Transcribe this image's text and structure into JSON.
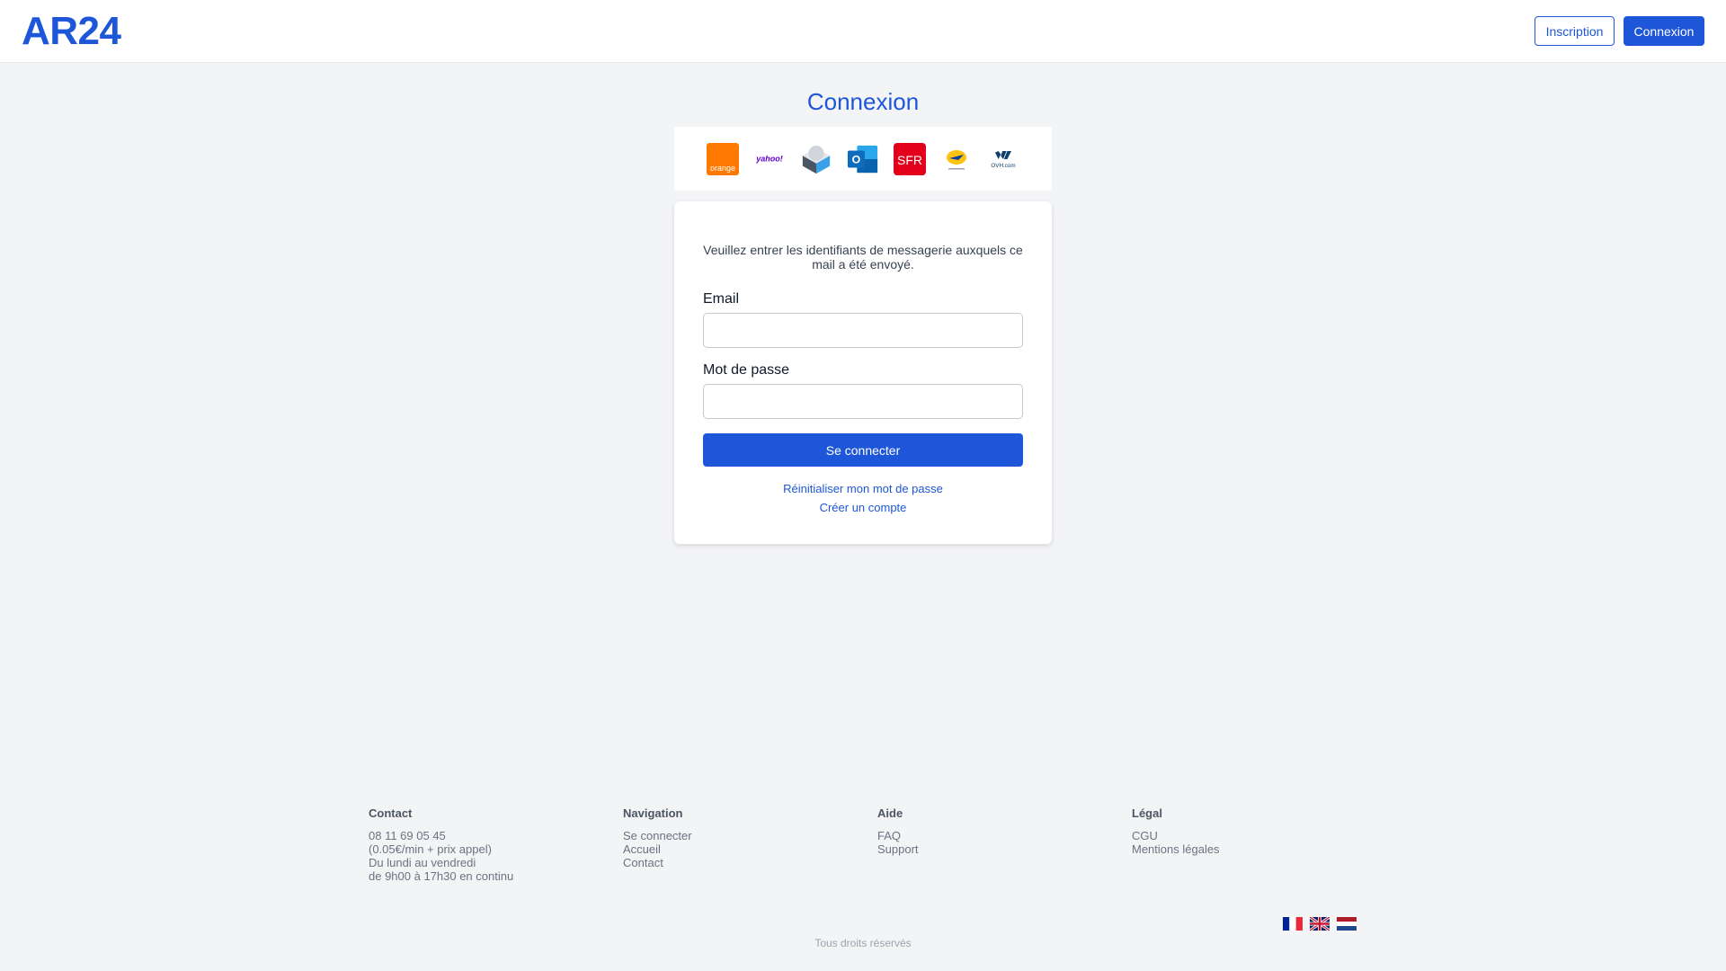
{
  "header": {
    "logo": "AR24",
    "signup_label": "Inscription",
    "login_label": "Connexion"
  },
  "page": {
    "title": "Connexion"
  },
  "providers": [
    {
      "name": "orange-logo-icon",
      "label": "orange"
    },
    {
      "name": "yahoo-logo-icon",
      "label": "yahoo!"
    },
    {
      "name": "mailbox-logo-icon"
    },
    {
      "name": "outlook-logo-icon",
      "label": "O"
    },
    {
      "name": "sfr-logo-icon",
      "label": "SFR"
    },
    {
      "name": "laposte-logo-icon"
    },
    {
      "name": "ovh-logo-icon",
      "label": "OVH.com"
    }
  ],
  "form": {
    "intro": "Veuillez entrer les identifiants de messagerie auxquels ce mail a été envoyé.",
    "email_label": "Email",
    "email_value": "",
    "password_label": "Mot de passe",
    "password_value": "",
    "submit_label": "Se connecter",
    "reset_link": "Réinitialiser mon mot de passe",
    "create_link": "Créer un compte"
  },
  "footer": {
    "contact": {
      "title": "Contact",
      "lines": [
        "08 11 69 05 45",
        "(0.05€/min + prix appel)",
        "Du lundi au vendredi",
        "de 9h00 à 17h30 en continu"
      ]
    },
    "navigation": {
      "title": "Navigation",
      "items": [
        "Se connecter",
        "Accueil",
        "Contact"
      ]
    },
    "aide": {
      "title": "Aide",
      "items": [
        "FAQ",
        "Support"
      ]
    },
    "legal": {
      "title": "Légal",
      "items": [
        "CGU",
        "Mentions légales"
      ]
    },
    "rights": "Tous droits réservés"
  },
  "colors": {
    "brand": "#1d56d8",
    "background": "#f3f4f6"
  }
}
